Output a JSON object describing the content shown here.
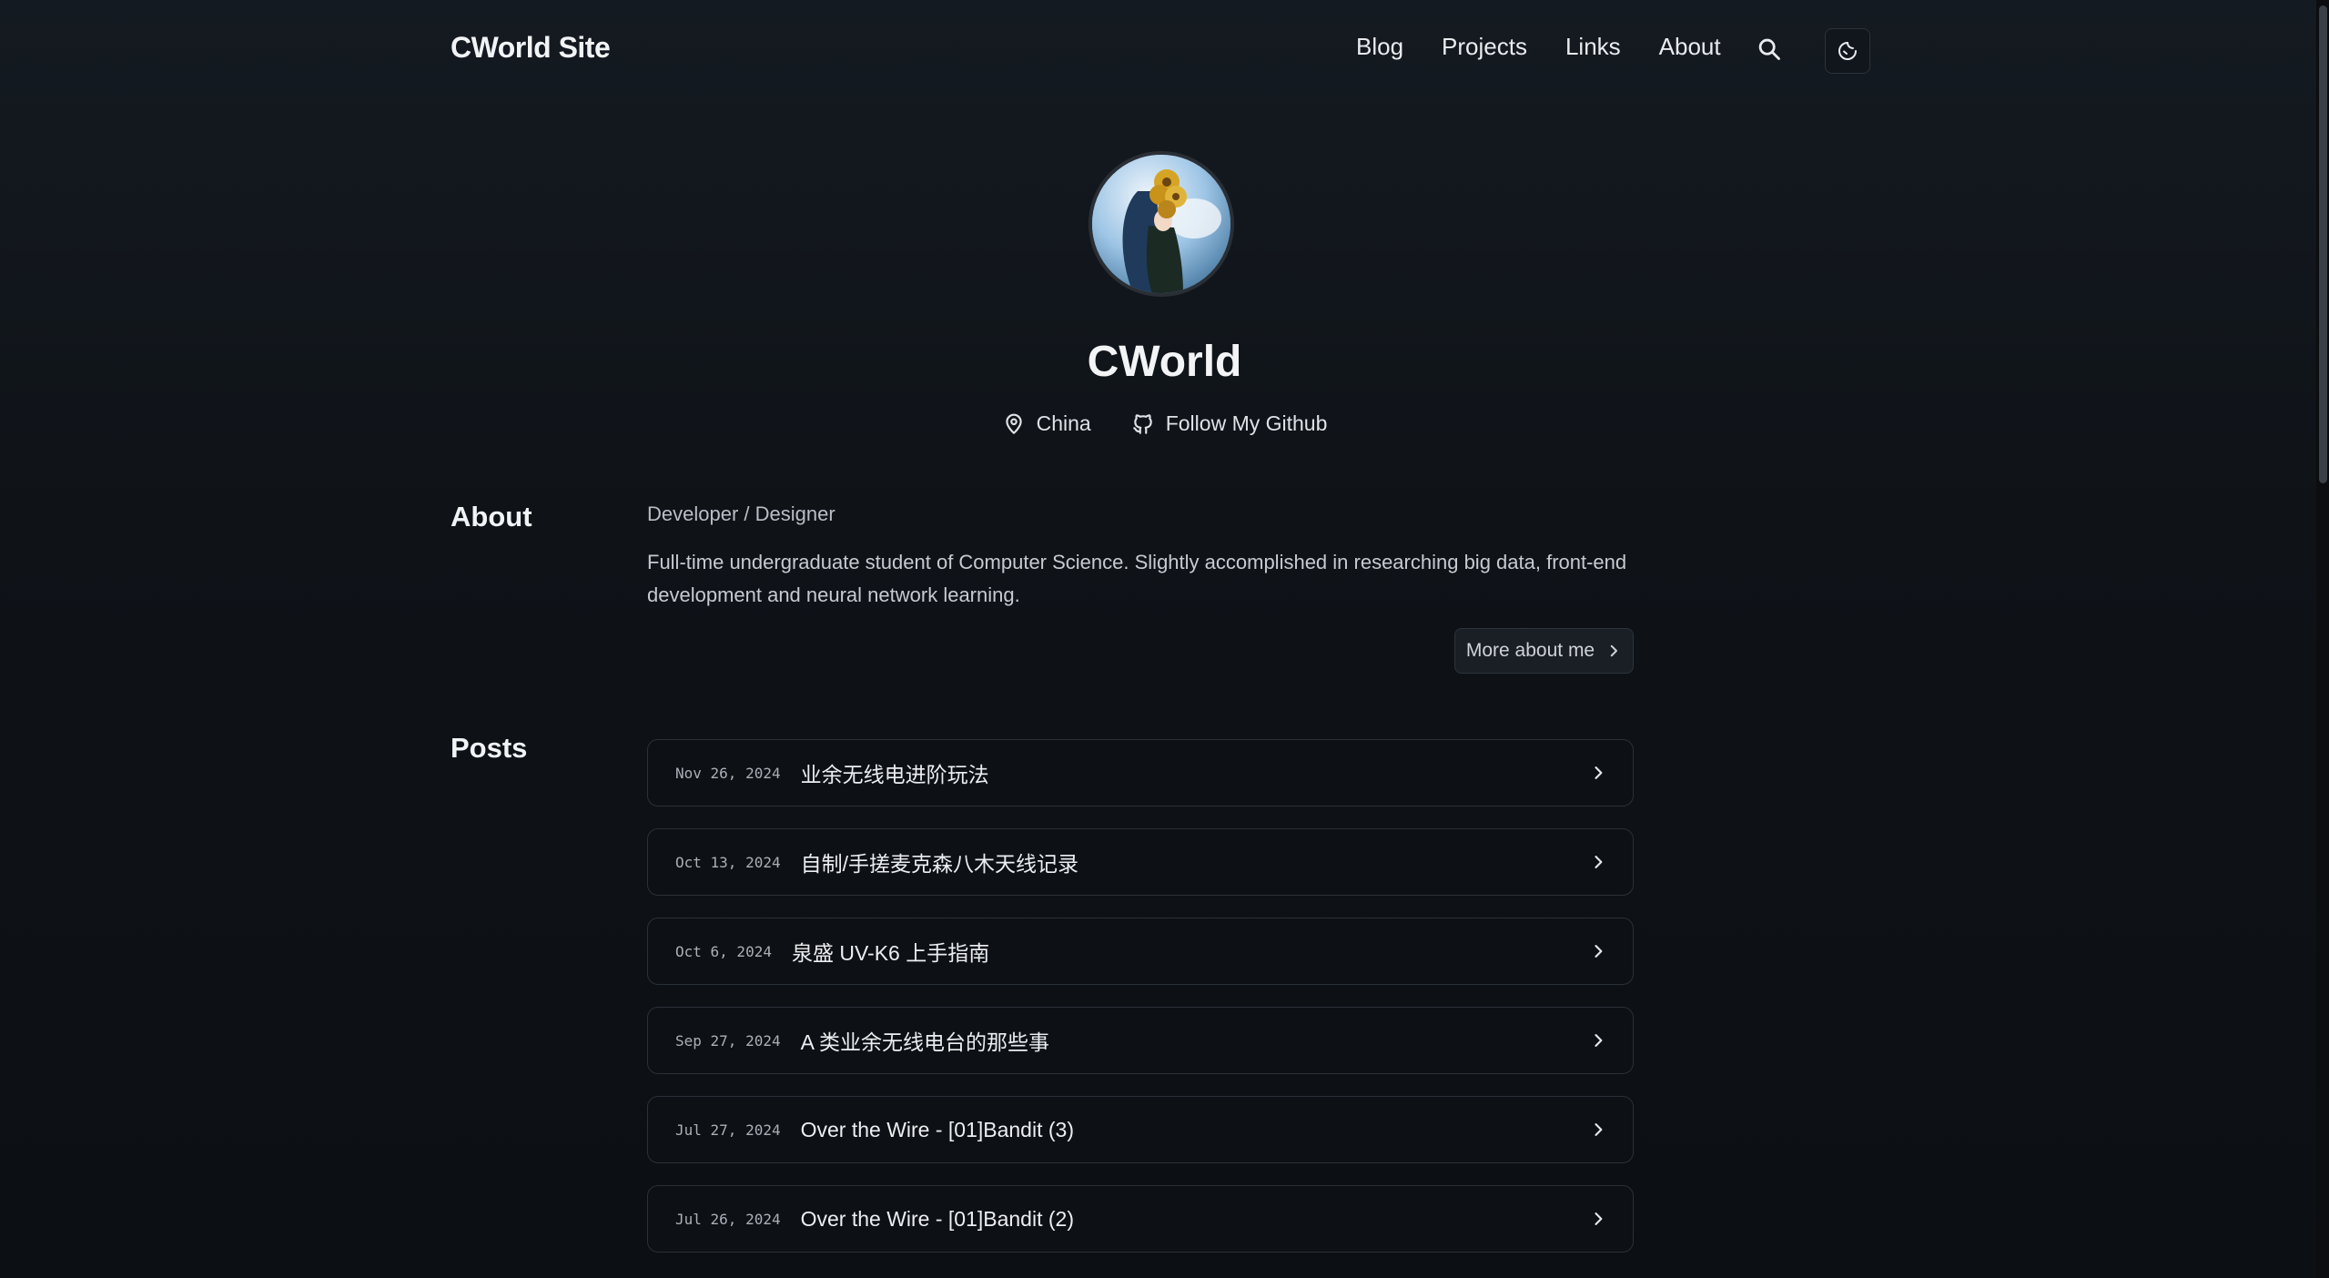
{
  "header": {
    "site_title": "CWorld Site",
    "nav": [
      "Blog",
      "Projects",
      "Links",
      "About"
    ],
    "search_icon": "search-icon",
    "theme_icon": "moon-icon"
  },
  "profile": {
    "name": "CWorld",
    "location": "China",
    "github_label": "Follow My Github",
    "avatar": "avatar-image"
  },
  "about": {
    "heading": "About",
    "role": "Developer / Designer",
    "description": "Full-time undergraduate student of Computer Science. Slightly accomplished in researching big data, front-end development and neural network learning.",
    "more_label": "More about me"
  },
  "posts": {
    "heading": "Posts",
    "items": [
      {
        "date": "Nov 26, 2024",
        "title": "业余无线电进阶玩法"
      },
      {
        "date": "Oct 13, 2024",
        "title": "自制/手搓麦克森八木天线记录"
      },
      {
        "date": "Oct 6, 2024",
        "title": "泉盛 UV-K6 上手指南"
      },
      {
        "date": "Sep 27, 2024",
        "title": "A 类业余无线电台的那些事"
      },
      {
        "date": "Jul 27, 2024",
        "title": "Over the Wire - [01]Bandit (3)"
      },
      {
        "date": "Jul 26, 2024",
        "title": "Over the Wire - [01]Bandit (2)"
      }
    ]
  },
  "colors": {
    "background": "#0e1116",
    "text": "#e6e8eb",
    "card_border": "#2b3139"
  }
}
